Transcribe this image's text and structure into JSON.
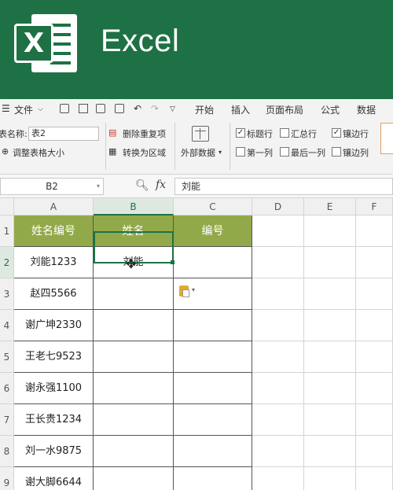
{
  "banner": {
    "title": "Excel"
  },
  "menu": {
    "file_label": "文件",
    "tabs": [
      "开始",
      "插入",
      "页面布局",
      "公式",
      "数据"
    ]
  },
  "table_tools": {
    "table_name_label": "表名称:",
    "table_name_value": "表2",
    "resize_label": "调整表格大小",
    "remove_duplicates_label": "删除重复项",
    "convert_to_range_label": "转换为区域",
    "external_data_label": "外部数据",
    "options": [
      {
        "label": "标题行",
        "checked": true
      },
      {
        "label": "汇总行",
        "checked": false
      },
      {
        "label": "镶边行",
        "checked": true
      },
      {
        "label": "第一列",
        "checked": false
      },
      {
        "label": "最后一列",
        "checked": false
      },
      {
        "label": "镶边列",
        "checked": false
      }
    ]
  },
  "formula_bar": {
    "name_box": "B2",
    "fx_label": "fx",
    "content": "刘能"
  },
  "sheet": {
    "columns": [
      "A",
      "B",
      "C",
      "D",
      "E",
      "F"
    ],
    "rows": [
      "1",
      "2",
      "3",
      "4",
      "5",
      "6",
      "7",
      "8",
      "9"
    ],
    "active_cell": "B2",
    "header_row": [
      "姓名编号",
      "姓名",
      "编号"
    ],
    "data": [
      [
        "刘能1233",
        "刘能",
        ""
      ],
      [
        "赵四5566",
        "",
        ""
      ],
      [
        "谢广坤2330",
        "",
        ""
      ],
      [
        "王老七9523",
        "",
        ""
      ],
      [
        "谢永强1100",
        "",
        ""
      ],
      [
        "王长贵1234",
        "",
        ""
      ],
      [
        "刘一水9875",
        "",
        ""
      ],
      [
        "谢大脚6644",
        "",
        ""
      ]
    ]
  },
  "colors": {
    "excel_green": "#1e7144",
    "table_header": "#92a94a"
  }
}
